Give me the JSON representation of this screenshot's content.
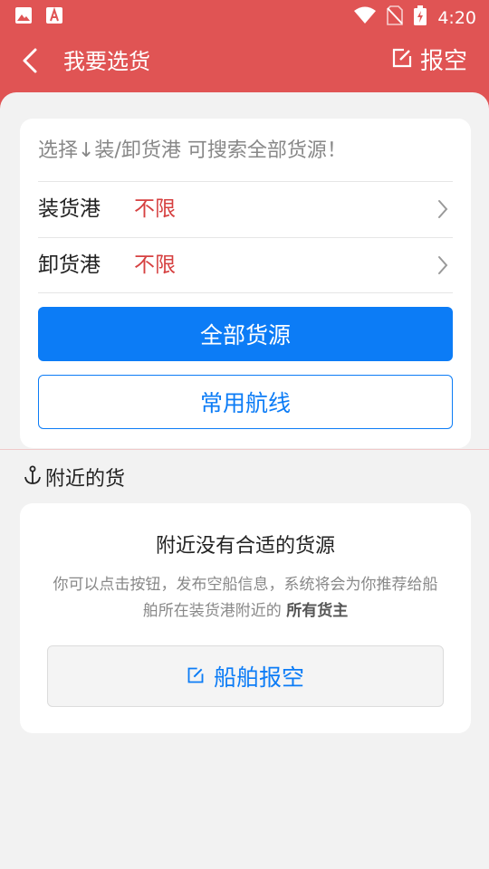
{
  "status_bar": {
    "time": "4:20",
    "icons": [
      "image-icon",
      "app-a-icon",
      "wifi-icon",
      "no-sim-icon",
      "battery-charging-icon"
    ]
  },
  "header": {
    "title": "我要选货",
    "report_label": "报空"
  },
  "search_card": {
    "hint": "选择↓装/卸货港 可搜索全部货源！",
    "load_port_label": "装货港",
    "load_port_value": "不限",
    "unload_port_label": "卸货港",
    "unload_port_value": "不限",
    "all_sources_button": "全部货源",
    "common_routes_button": "常用航线"
  },
  "nearby": {
    "section_title": "附近的货",
    "empty_title": "附近没有合适的货源",
    "empty_desc": "你可以点击按钮，发布空船信息，系统将会为你推荐给船舶所在装货港附近的",
    "empty_desc_bold": "所有货主",
    "ship_report_button": "船舶报空"
  },
  "colors": {
    "header_red": "#e05454",
    "primary_blue": "#0c7cf6",
    "value_red": "#d64141"
  }
}
